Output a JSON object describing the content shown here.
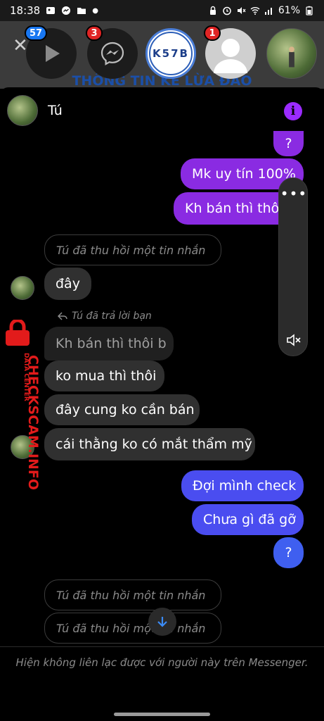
{
  "status_bar": {
    "time": "18:38",
    "battery": "61%"
  },
  "background_page": {
    "title": "THÔNG TIN KẺ LỪA ĐẢO"
  },
  "chat_heads": [
    {
      "name": "video-app",
      "badge": "57",
      "badge_color": "#1877f2"
    },
    {
      "name": "messenger",
      "badge": "3",
      "badge_color": "#e02424"
    },
    {
      "name": "K57B",
      "label": "K57B"
    },
    {
      "name": "blank-contact",
      "badge": "1",
      "badge_color": "#e02424"
    },
    {
      "name": "tu-contact"
    }
  ],
  "chat": {
    "contact_name": "Tú",
    "messages": {
      "sent_q1": "?",
      "sent_uytin": "Mk uy tín 100%",
      "sent_khban": "Kh bán thì thôi",
      "recalled_1": "Tú đã thu hồi một tin nhắn",
      "recv_day": "đây",
      "reply_label": "Tú đã trả lời bạn",
      "reply_preview": "Kh bán thì thôi b",
      "recv_komua": "ko mua thì thôi",
      "recv_daycung": "đây cung ko cần bán",
      "recv_caithang": "cái thằng ko có mắt thẩm mỹ",
      "sent_doi": "Đợi mình check",
      "sent_chuagi": "Chưa gì đã gỡ",
      "sent_q2": "?",
      "recalled_2": "Tú đã thu hồi một tin nhắn",
      "recalled_3": "Tú đã thu hồi một tin nhắn"
    },
    "footer_note": "Hiện không liên lạc được với người này trên Messenger."
  },
  "watermark": {
    "main": "CHECKSCAM.INFO",
    "sub": "DATA CENTER"
  },
  "colors": {
    "accent_purple": "#9b2bff",
    "sent_purple": "#8a2be2",
    "sent_blue": "#4a4df0",
    "watermark_red": "#e21b1b"
  }
}
